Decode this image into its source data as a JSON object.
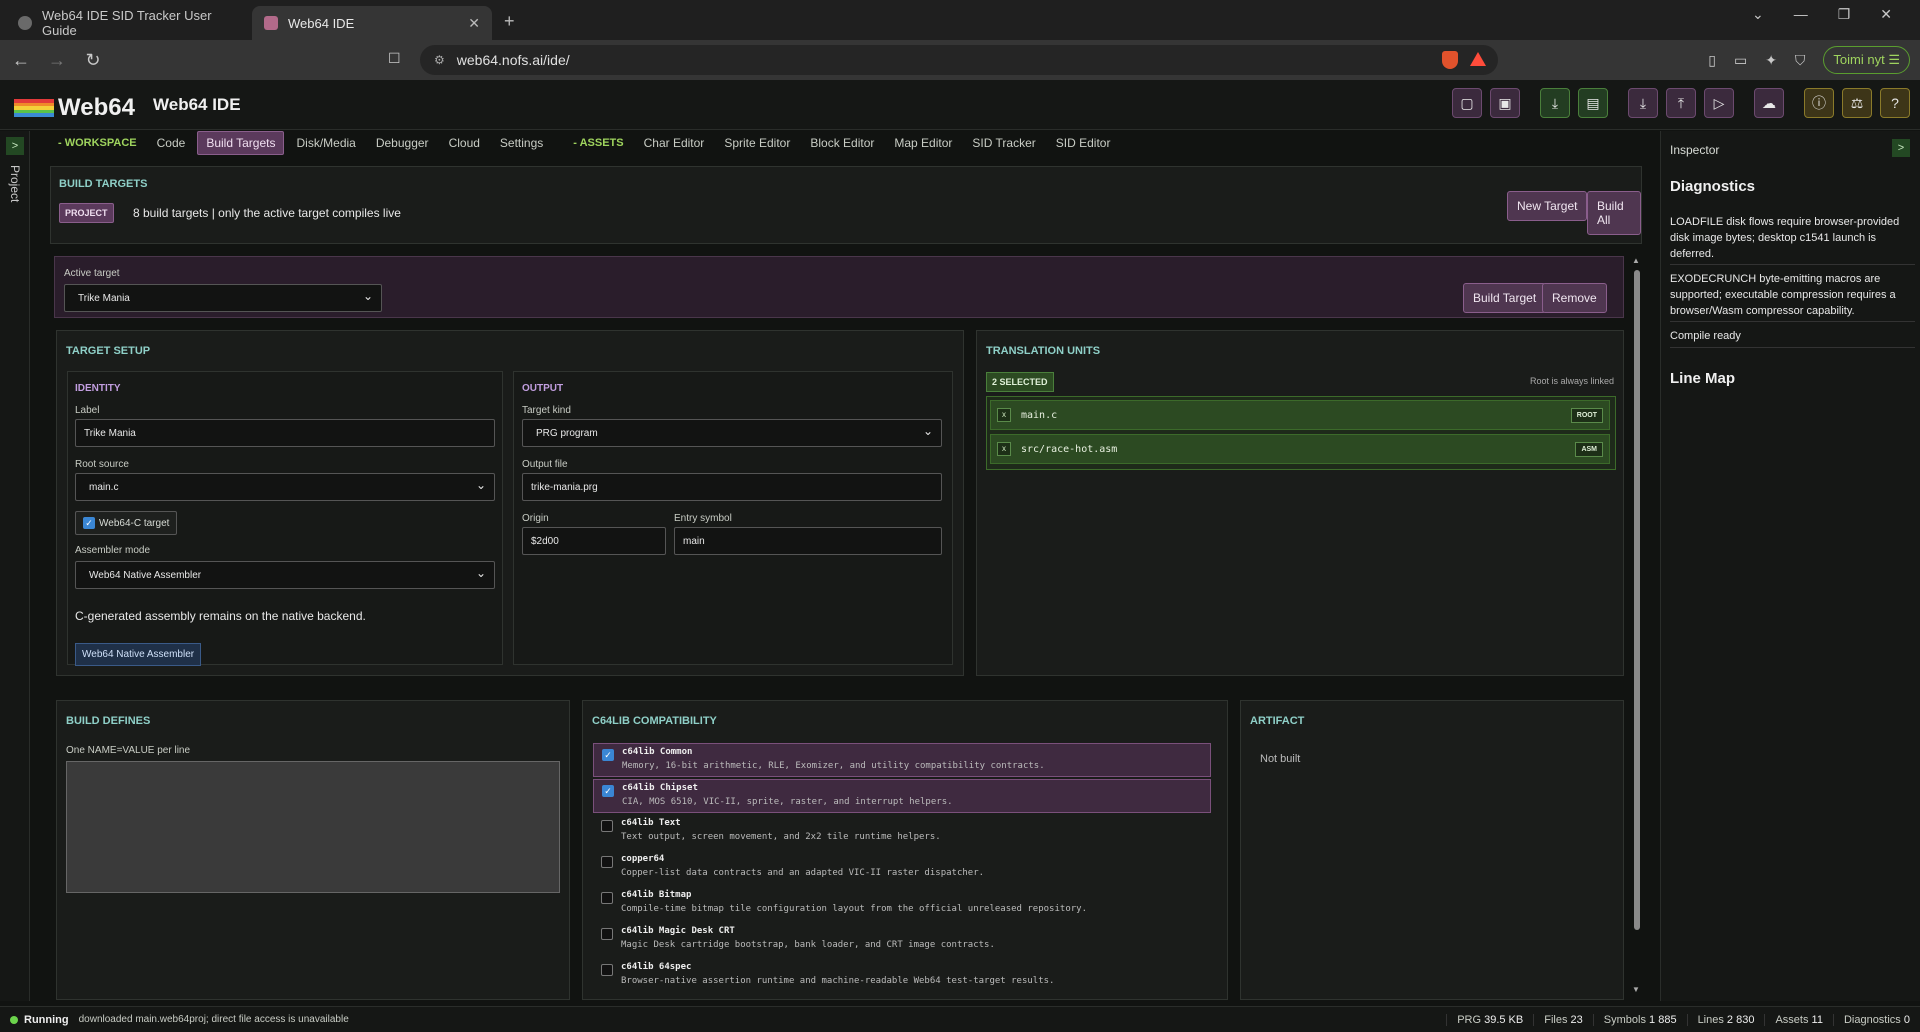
{
  "browser": {
    "tabs": [
      {
        "title": "Web64 IDE SID Tracker User Guide"
      },
      {
        "title": "Web64 IDE"
      }
    ],
    "url": "web64.nofs.ai/ide/",
    "profile_button": "Toimi nyt"
  },
  "app": {
    "logo": "Web64",
    "title": "Web64 IDE"
  },
  "left_rail": {
    "button": ">",
    "label": "Project"
  },
  "nav": {
    "workspace": "- WORKSPACE",
    "code": "Code",
    "build_targets": "Build Targets",
    "disk": "Disk/Media",
    "debugger": "Debugger",
    "cloud": "Cloud",
    "settings": "Settings",
    "assets": "- ASSETS",
    "char_editor": "Char Editor",
    "sprite_editor": "Sprite Editor",
    "block_editor": "Block Editor",
    "map_editor": "Map Editor",
    "sid_tracker": "SID Tracker",
    "sid_editor": "SID Editor"
  },
  "build_targets": {
    "title": "BUILD TARGETS",
    "badge": "PROJECT",
    "summary": "8 build targets | only the active target compiles live",
    "new_target": "New Target",
    "build_all": "Build All"
  },
  "active": {
    "label": "Active target",
    "value": "Trike Mania",
    "build_target": "Build Target",
    "remove": "Remove"
  },
  "setup": {
    "title": "TARGET SETUP",
    "identity": {
      "title": "IDENTITY",
      "label_label": "Label",
      "label_value": "Trike Mania",
      "root_label": "Root source",
      "root_value": "main.c",
      "web64c": "Web64-C target",
      "web64c_checked": true,
      "asm_label": "Assembler mode",
      "asm_value": "Web64 Native Assembler",
      "note": "C-generated assembly remains on the native backend.",
      "chip": "Web64 Native Assembler"
    },
    "output": {
      "title": "OUTPUT",
      "kind_label": "Target kind",
      "kind_value": "PRG program",
      "file_label": "Output file",
      "file_value": "trike-mania.prg",
      "origin_label": "Origin",
      "origin_value": "$2d00",
      "entry_label": "Entry symbol",
      "entry_value": "main"
    }
  },
  "translation": {
    "title": "TRANSLATION UNITS",
    "selected": "2 SELECTED",
    "note": "Root is always linked",
    "units": [
      {
        "x": "x",
        "name": "main.c",
        "tag": "ROOT"
      },
      {
        "x": "x",
        "name": "src/race-hot.asm",
        "tag": "ASM"
      }
    ]
  },
  "defines": {
    "title": "BUILD DEFINES",
    "hint": "One NAME=VALUE per line",
    "value": ""
  },
  "compat": {
    "title": "C64LIB COMPATIBILITY",
    "libs": [
      {
        "name": "c64lib Common",
        "desc": "Memory, 16-bit arithmetic, RLE, Exomizer, and utility compatibility contracts.",
        "checked": true
      },
      {
        "name": "c64lib Chipset",
        "desc": "CIA, MOS 6510, VIC-II, sprite, raster, and interrupt helpers.",
        "checked": true
      },
      {
        "name": "c64lib Text",
        "desc": "Text output, screen movement, and 2x2 tile runtime helpers.",
        "checked": false
      },
      {
        "name": "copper64",
        "desc": "Copper-list data contracts and an adapted VIC-II raster dispatcher.",
        "checked": false
      },
      {
        "name": "c64lib Bitmap",
        "desc": "Compile-time bitmap tile configuration layout from the official unreleased repository.",
        "checked": false
      },
      {
        "name": "c64lib Magic Desk CRT",
        "desc": "Magic Desk cartridge bootstrap, bank loader, and CRT image contracts.",
        "checked": false
      },
      {
        "name": "c64lib 64spec",
        "desc": "Browser-native assertion runtime and machine-readable Web64 test-target results.",
        "checked": false
      }
    ]
  },
  "artifact": {
    "title": "ARTIFACT",
    "status": "Not built"
  },
  "inspector": {
    "title": "Inspector",
    "button": ">",
    "diagnostics_title": "Diagnostics",
    "diagnostics": [
      "LOADFILE disk flows require browser-provided disk image bytes; desktop c1541 launch is deferred.",
      "EXODECRUNCH byte-emitting macros are supported; executable compression requires a browser/Wasm compressor capability.",
      "Compile ready"
    ],
    "line_map_title": "Line Map"
  },
  "status": {
    "state": "Running",
    "message": "downloaded main.web64proj; direct file access is unavailable",
    "prg_label": "PRG",
    "prg_value": "39.5 KB",
    "files_label": "Files",
    "files_value": "23",
    "symbols_label": "Symbols",
    "symbols_value": "1 885",
    "lines_label": "Lines",
    "lines_value": "2 830",
    "assets_label": "Assets",
    "assets_value": "11",
    "diagnostics_label": "Diagnostics",
    "diagnostics_value": "0"
  },
  "colors": {
    "accent_purple": "#5b3a5c",
    "accent_green": "#2c4a22",
    "section_teal": "#8fd0c8",
    "running_green": "#6cd44c"
  }
}
